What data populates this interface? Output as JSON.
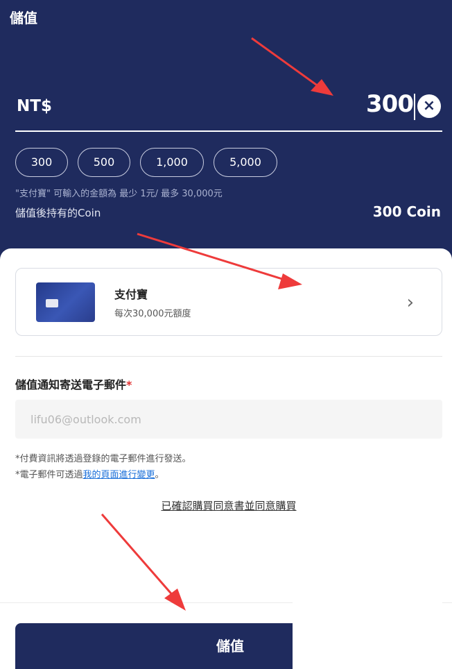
{
  "header": {
    "title": "儲值"
  },
  "amount": {
    "currency": "NT$",
    "value": "300",
    "clear_icon": "close-circle-icon"
  },
  "presets": [
    "300",
    "500",
    "1,000",
    "5,000"
  ],
  "limit_hint": "\"支付寶\" 可輸入的金額為 最少 1元/ 最多 30,000元",
  "coin": {
    "label": "儲值後持有的Coin",
    "value": "300 Coin"
  },
  "payment": {
    "name": "支付寶",
    "subtitle": "每次30,000元額度",
    "chevron_icon": "chevron-right-icon"
  },
  "email": {
    "label": "儲值通知寄送電子郵件",
    "required_mark": "*",
    "placeholder": "lifu06@outlook.com"
  },
  "notes": {
    "line1": "*付費資訊將透過登錄的電子郵件進行發送。",
    "line2_prefix": "*電子郵件可透過",
    "line2_link": "我的頁面進行變更",
    "line2_suffix": "。"
  },
  "agree_text": "已確認購買同意書並同意購買",
  "submit_label": "儲值",
  "colors": {
    "primary": "#1f2b5e",
    "arrow": "#ee3b3b",
    "required": "#e03030",
    "link": "#1a6fd9"
  }
}
